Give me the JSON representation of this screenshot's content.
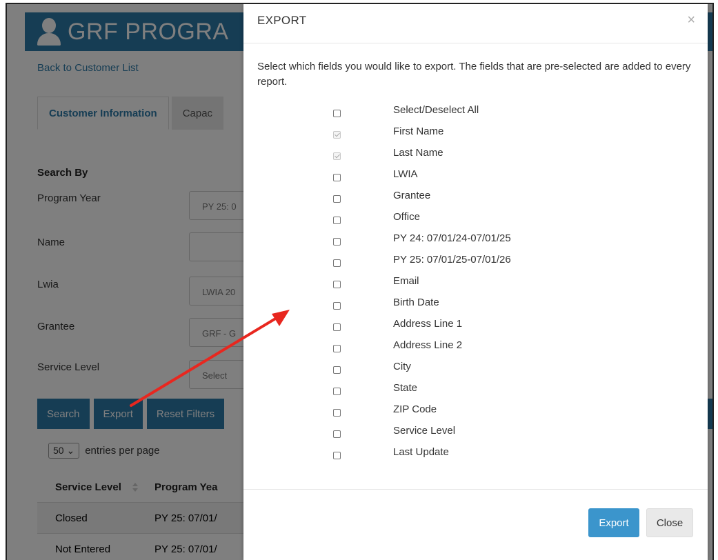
{
  "background": {
    "banner_title": "GRF PROGRA",
    "back_link": "Back to Customer List",
    "tabs": [
      {
        "label": "Customer Information"
      },
      {
        "label": "Capac"
      }
    ],
    "search_by": "Search By",
    "filters": [
      {
        "label": "Program Year",
        "value": "PY 25: 0"
      },
      {
        "label": "Name",
        "value": ""
      },
      {
        "label": "Lwia",
        "value": "LWIA 20"
      },
      {
        "label": "Grantee",
        "value": "GRF - G"
      },
      {
        "label": "Service Level",
        "value": "Select"
      }
    ],
    "buttons": {
      "search": "Search",
      "export": "Export",
      "reset": "Reset Filters"
    },
    "entries": {
      "value": "50",
      "label": "entries per page"
    },
    "table": {
      "headers": [
        "Service Level",
        "Program Yea"
      ],
      "rows": [
        [
          "Closed",
          "PY 25: 07/01/"
        ],
        [
          "Not Entered",
          "PY 25: 07/01/"
        ]
      ]
    }
  },
  "modal": {
    "title": "EXPORT",
    "close_glyph": "×",
    "description": "Select which fields you would like to export. The fields that are pre-selected are added to every report.",
    "fields": [
      {
        "label": "Select/Deselect All",
        "checked": false
      },
      {
        "label": "First Name",
        "checked": true
      },
      {
        "label": "Last Name",
        "checked": true
      },
      {
        "label": "LWIA",
        "checked": false
      },
      {
        "label": "Grantee",
        "checked": false
      },
      {
        "label": "Office",
        "checked": false
      },
      {
        "label": "PY 24: 07/01/24-07/01/25",
        "checked": false
      },
      {
        "label": "PY 25: 07/01/25-07/01/26",
        "checked": false
      },
      {
        "label": "Email",
        "checked": false
      },
      {
        "label": "Birth Date",
        "checked": false
      },
      {
        "label": "Address Line 1",
        "checked": false
      },
      {
        "label": "Address Line 2",
        "checked": false
      },
      {
        "label": "City",
        "checked": false
      },
      {
        "label": "State",
        "checked": false
      },
      {
        "label": "ZIP Code",
        "checked": false
      },
      {
        "label": "Service Level",
        "checked": false
      },
      {
        "label": "Last Update",
        "checked": false
      }
    ],
    "buttons": {
      "export": "Export",
      "close": "Close"
    }
  },
  "colors": {
    "brand": "#2d7aa8",
    "export_button": "#3b95cc",
    "annotation_arrow": "#e8271f"
  }
}
